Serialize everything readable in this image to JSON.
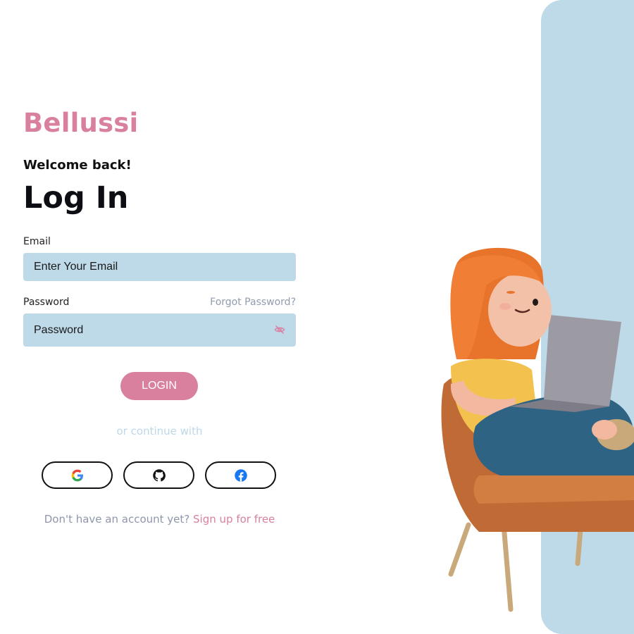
{
  "brand": {
    "name": "Bellussi"
  },
  "header": {
    "welcome": "Welcome back!",
    "title": "Log In"
  },
  "form": {
    "email_label": "Email",
    "email_placeholder": "Enter Your Email",
    "password_label": "Password",
    "password_placeholder": "Password",
    "forgot_password": "Forgot Password?",
    "login_button": "LOGIN"
  },
  "social": {
    "divider_text": "or continue with",
    "providers": [
      "google-icon",
      "github-icon",
      "facebook-icon"
    ]
  },
  "footer": {
    "prompt": "Don't have an account yet?",
    "signup_link": "Sign up for free"
  },
  "colors": {
    "brand_pink": "#d9809f",
    "field_blue": "#bed9e8",
    "muted_text": "#8e96ac"
  },
  "illustration": {
    "icon": "woman-on-chair-with-laptop-illustration"
  }
}
